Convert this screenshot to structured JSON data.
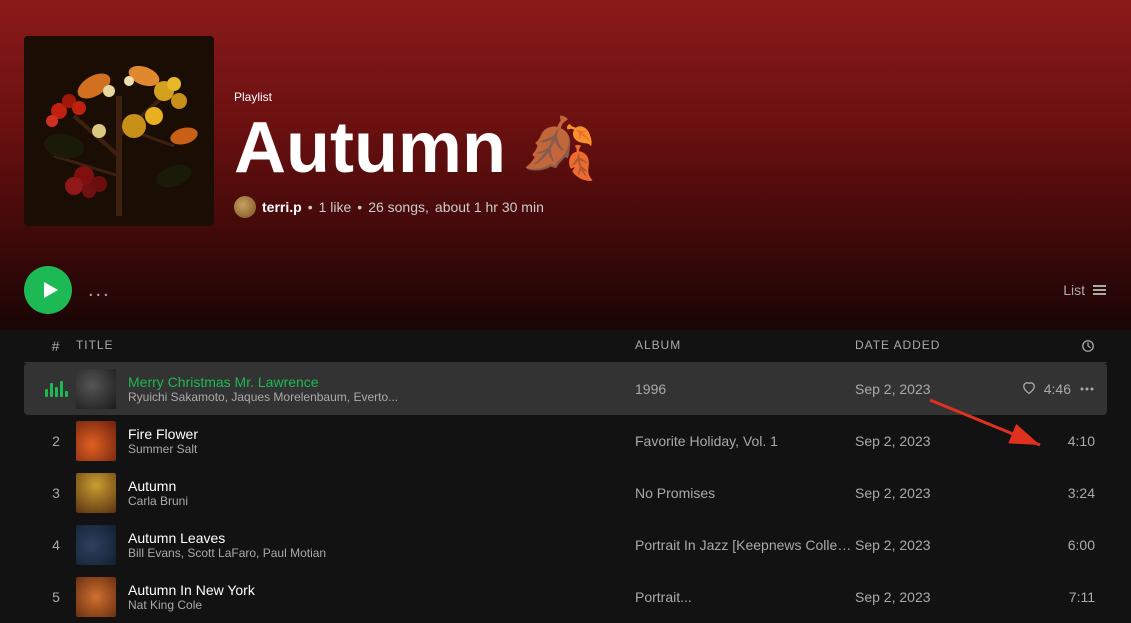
{
  "header": {
    "playlist_label": "Playlist",
    "title": "Autumn",
    "leaf": "🍂",
    "avatar_alt": "terri.p avatar",
    "username": "terri.p",
    "likes": "1 like",
    "songs": "26 songs,",
    "duration": "about 1 hr 30 min"
  },
  "controls": {
    "play_label": "Play",
    "more_label": "...",
    "list_label": "List"
  },
  "table": {
    "col_num": "#",
    "col_title": "Title",
    "col_album": "Album",
    "col_date": "Date added",
    "col_dur_icon": "🕐"
  },
  "tracks": [
    {
      "num": "▶",
      "title": "Merry Christmas Mr. Lawrence",
      "artist": "Ryuichi Sakamoto, Jaques Morelenbaum, Everto...",
      "album": "1996",
      "date": "Sep 2, 2023",
      "duration": "4:46",
      "playing": true,
      "thumb_class": "thumb-1"
    },
    {
      "num": "2",
      "title": "Fire Flower",
      "artist": "Summer Salt",
      "album": "Favorite Holiday, Vol. 1",
      "date": "Sep 2, 2023",
      "duration": "4:10",
      "playing": false,
      "thumb_class": "thumb-2"
    },
    {
      "num": "3",
      "title": "Autumn",
      "artist": "Carla Bruni",
      "album": "No Promises",
      "date": "Sep 2, 2023",
      "duration": "3:24",
      "playing": false,
      "thumb_class": "thumb-3"
    },
    {
      "num": "4",
      "title": "Autumn Leaves",
      "artist": "Bill Evans, Scott LaFaro, Paul Motian",
      "album": "Portrait In Jazz [Keepnews Collection]",
      "date": "Sep 2, 2023",
      "duration": "6:00",
      "playing": false,
      "thumb_class": "thumb-4"
    },
    {
      "num": "5",
      "title": "Autumn In New York",
      "artist": "Nat King Cole",
      "album": "Portrait...",
      "date": "Sep 2, 2023",
      "duration": "7:11",
      "playing": false,
      "thumb_class": "thumb-5"
    }
  ]
}
